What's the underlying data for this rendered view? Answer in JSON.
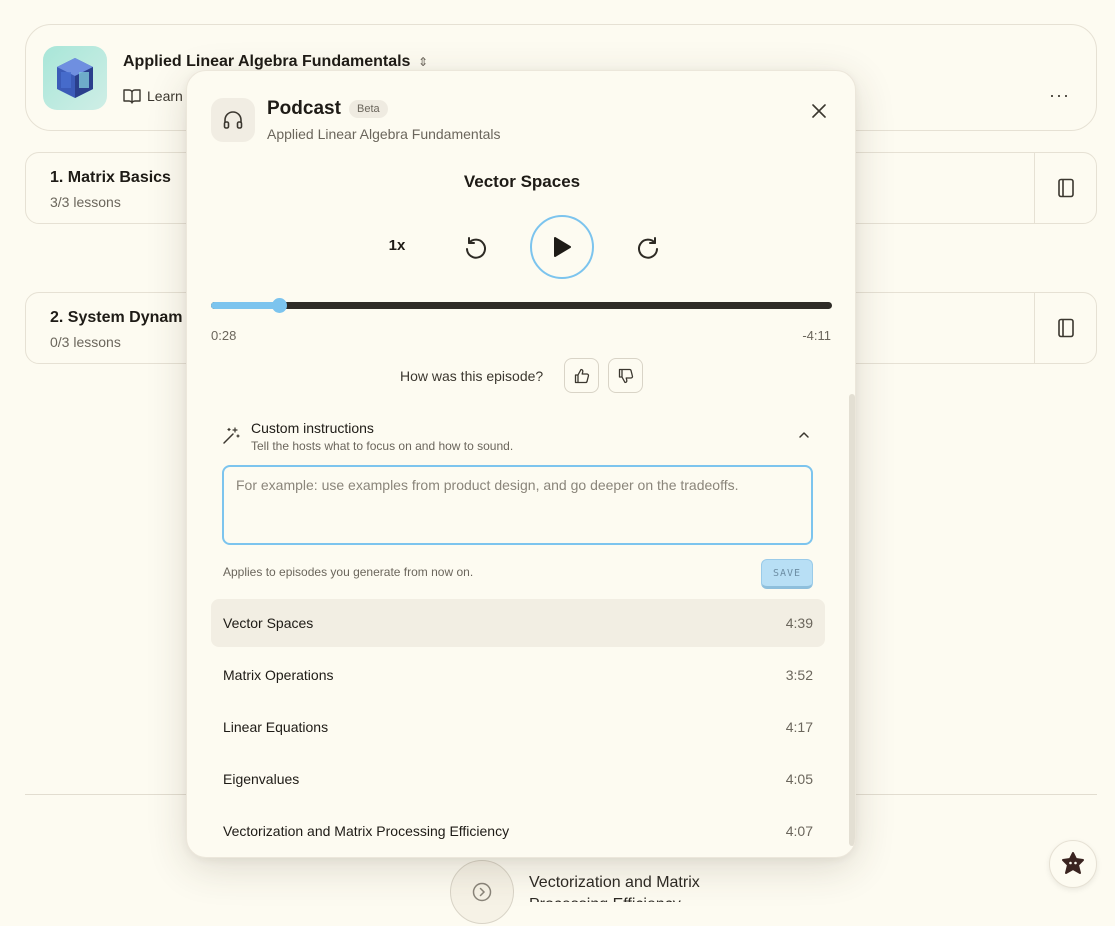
{
  "course": {
    "title": "Applied Linear Algebra Fundamentals",
    "learn_label": "Learn"
  },
  "sections": [
    {
      "title": "1. Matrix Basics",
      "progress": "3/3 lessons"
    },
    {
      "title": "2. System Dynam",
      "progress": "0/3 lessons"
    }
  ],
  "next_up": {
    "title": "Vectorization and Matrix Processing Efficiency"
  },
  "podcast": {
    "title": "Podcast",
    "badge": "Beta",
    "subtitle": "Applied Linear Algebra Fundamentals",
    "current_episode": "Vector Spaces",
    "speed": "1x",
    "elapsed": "0:28",
    "remaining": "-4:11",
    "progress_fraction": 0.11,
    "feedback_prompt": "How was this episode?",
    "custom_instructions": {
      "title": "Custom instructions",
      "subtitle": "Tell the hosts what to focus on and how to sound.",
      "placeholder": "For example: use examples from product design, and go deeper on the tradeoffs.",
      "value": "",
      "note": "Applies to episodes you generate from now on.",
      "save_label": "SAVE"
    },
    "episodes": [
      {
        "title": "Vector Spaces",
        "duration": "4:39",
        "active": true
      },
      {
        "title": "Matrix Operations",
        "duration": "3:52"
      },
      {
        "title": "Linear Equations",
        "duration": "4:17"
      },
      {
        "title": "Eigenvalues",
        "duration": "4:05"
      },
      {
        "title": "Vectorization and Matrix Processing Efficiency",
        "duration": "4:07"
      }
    ]
  },
  "colors": {
    "accent": "#7cc4ee",
    "background": "#fdfbf1",
    "track": "#2e2b26"
  }
}
